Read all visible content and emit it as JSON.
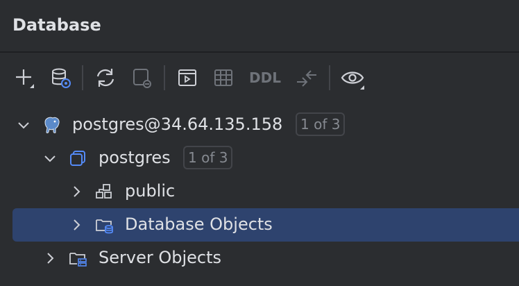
{
  "panel": {
    "title": "Database"
  },
  "toolbar": {
    "ddl_label": "DDL"
  },
  "tree": {
    "connection": {
      "label": "postgres@34.64.135.158",
      "badge": "1 of 3"
    },
    "database": {
      "label": "postgres",
      "badge": "1 of 3"
    },
    "schema": {
      "label": "public"
    },
    "db_objects": {
      "label": "Database Objects"
    },
    "server_objects": {
      "label": "Server Objects"
    }
  },
  "colors": {
    "background": "#2b2d30",
    "selection": "#2e436e",
    "accent_blue": "#548af7",
    "muted": "#6f737a"
  }
}
